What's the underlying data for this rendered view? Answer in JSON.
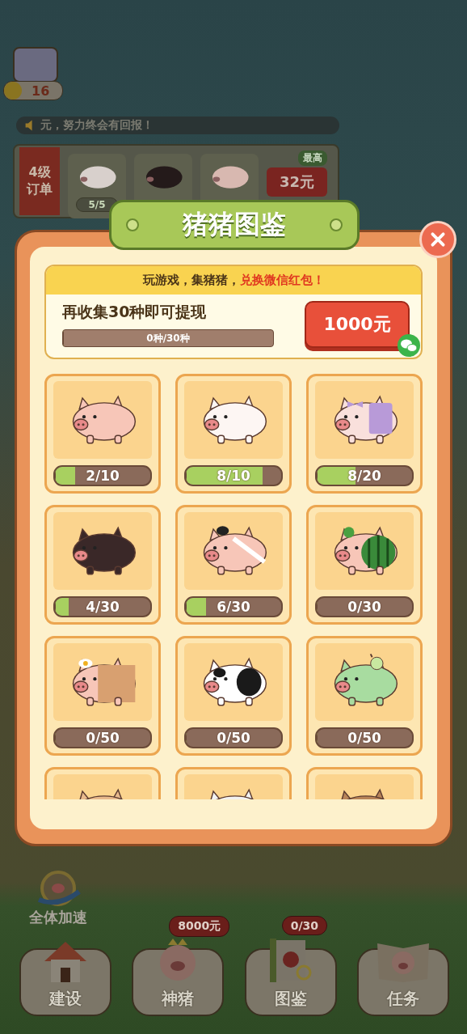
{
  "background": {
    "coins": "16",
    "notice": "元，努力终会有回报！",
    "order": {
      "level_label": "4级",
      "title": "订单",
      "pigs": [
        {
          "color": "#d8d0cc"
        },
        {
          "color": "#241a1a"
        },
        {
          "color": "#d8b8b0"
        }
      ],
      "progress": "5/5",
      "top_tag": "最高",
      "reward": "32元"
    },
    "speedup": "全体加速",
    "nav": [
      {
        "kind": "house",
        "label": "建设"
      },
      {
        "kind": "king",
        "label": "神猪",
        "badge": "8000元"
      },
      {
        "kind": "book",
        "label": "图鉴",
        "badge": "0/30"
      },
      {
        "kind": "storybook",
        "label": "任务"
      }
    ]
  },
  "modal": {
    "title": "猪猪图鉴",
    "slogan": "玩游戏，集猪猪，",
    "slogan_highlight": "兑换微信红包！",
    "goal": "再收集30种即可提现",
    "progress": "0种/30种",
    "level": 0,
    "reward_button": "1000元",
    "cards": [
      {
        "kind": "plain",
        "color": "#f7c6b8",
        "count": "2/10",
        "level": 0.2
      },
      {
        "kind": "plain",
        "color": "#fdf6f3",
        "count": "8/10",
        "level": 0.8
      },
      {
        "kind": "bow",
        "color": "#f9e0dc",
        "count": "8/20",
        "level": 0.4
      },
      {
        "kind": "plain",
        "color": "#3a2828",
        "count": "4/30",
        "level": 0.133
      },
      {
        "kind": "topknot",
        "color": "#f7c6b8",
        "count": "6/30",
        "level": 0.2
      },
      {
        "kind": "melon",
        "color": "#f7c6b8",
        "count": "0/30",
        "level": 0
      },
      {
        "kind": "toast",
        "color": "#f7c6b8",
        "count": "0/50",
        "level": 0
      },
      {
        "kind": "panda",
        "color": "#ffffff",
        "count": "0/50",
        "level": 0
      },
      {
        "kind": "fruit",
        "color": "#a8dca0",
        "count": "0/50",
        "level": 0
      },
      {
        "kind": "plain",
        "color": "#e8b98c"
      },
      {
        "kind": "plain",
        "color": "#f2f2f2"
      },
      {
        "kind": "plain",
        "color": "#b88458"
      }
    ]
  }
}
